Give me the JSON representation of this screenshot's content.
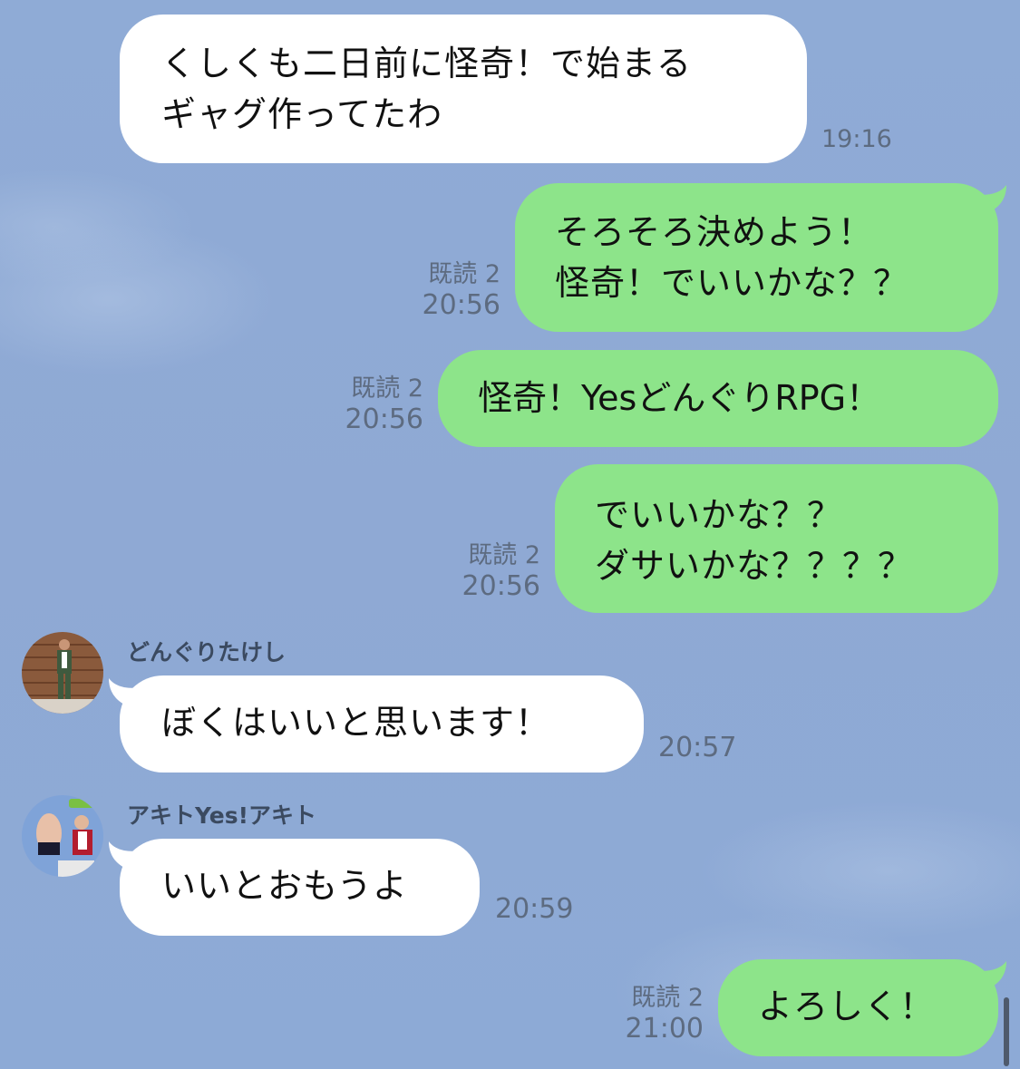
{
  "messages": [
    {
      "id": "m1",
      "direction": "in",
      "text": "くしくも二日前に怪奇！で始まる\nギャグ作ってたわ",
      "time": "19:16"
    },
    {
      "id": "m2",
      "direction": "out",
      "text": "そろそろ決めよう！\n怪奇！でいいかな？？",
      "read": "既読 2",
      "time": "20:56"
    },
    {
      "id": "m3",
      "direction": "out",
      "text": "怪奇！YesどんぐりRPG！",
      "read": "既読 2",
      "time": "20:56"
    },
    {
      "id": "m4",
      "direction": "out",
      "text": "でいいかな？？\nダサいかな？？？？",
      "read": "既読 2",
      "time": "20:56"
    },
    {
      "id": "m5",
      "direction": "in",
      "sender": "どんぐりたけし",
      "text": "ぼくはいいと思います！",
      "time": "20:57"
    },
    {
      "id": "m6",
      "direction": "in",
      "sender": "アキトYes!アキト",
      "text": "いいとおもうよ",
      "time": "20:59"
    },
    {
      "id": "m7",
      "direction": "out",
      "text": "よろしく！",
      "read": "既読 2",
      "time": "21:00"
    }
  ],
  "colors": {
    "background": "#8eacd6",
    "incoming_bubble": "#ffffff",
    "outgoing_bubble": "#8de48a",
    "meta_text": "#5d6b80"
  },
  "icons": {
    "avatar_1": "avatar-photo",
    "avatar_2": "avatar-photo"
  }
}
